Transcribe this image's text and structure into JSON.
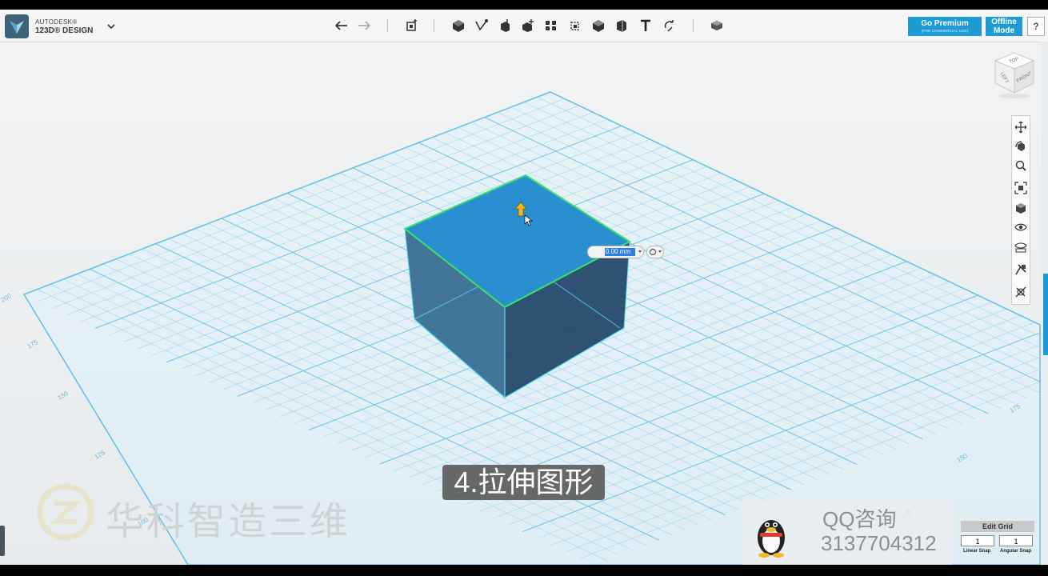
{
  "app": {
    "brand_line1": "AUTODESK®",
    "brand_line2": "123D® DESIGN"
  },
  "toolbar": {
    "tools": [
      "undo-icon",
      "redo-icon",
      "transform-icon",
      "primitives-icon",
      "sketch-icon",
      "construct-icon",
      "modify-icon",
      "pattern-icon",
      "grouping-icon",
      "combine-icon",
      "measure-icon",
      "text-icon",
      "snap-icon",
      "material-icon"
    ]
  },
  "premium": {
    "label": "Go Premium",
    "sub": "(FOR COMMERCIAL USE)"
  },
  "offline": {
    "line1": "Offline",
    "line2": "Mode"
  },
  "help": {
    "label": "?"
  },
  "viewcube": {
    "top": "TOP",
    "left": "LEFT",
    "front": "FRONT"
  },
  "extrude": {
    "value": "0.00 mm"
  },
  "axis_labels": [
    "200",
    "175",
    "150",
    "125",
    "100",
    "175",
    "150",
    "125"
  ],
  "caption": "4.拉伸图形",
  "watermark": {
    "text": "华科智造三维"
  },
  "qq": {
    "label": "QQ咨询",
    "number": "3137704312"
  },
  "edit_grid": {
    "title": "Edit Grid",
    "linear_value": "1",
    "angular_value": "1",
    "linear_label": "Linear Snap",
    "angular_label": "Angular Snap"
  },
  "colors": {
    "accent": "#1c9bd6",
    "grid_line": "#8fd0ea",
    "box_top": "#2a8fd0",
    "selection": "#39e06a"
  }
}
